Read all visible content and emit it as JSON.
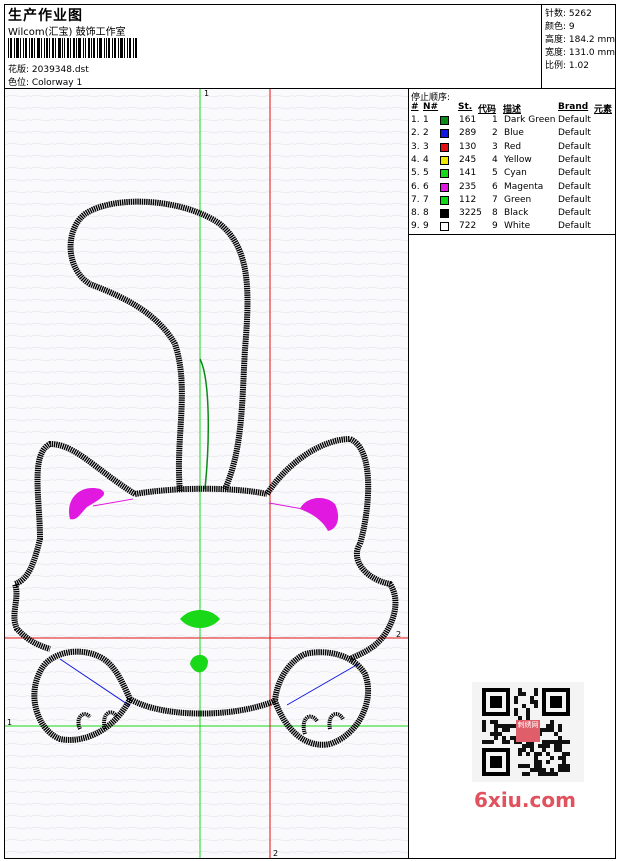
{
  "header": {
    "title": "生产作业图",
    "company": "Wilcom(汇宝) 鼓饰工作室",
    "design_label": "花版: 2039348.dst",
    "colorway_label": "色位: Colorway 1"
  },
  "stats": {
    "stitches": "针数: 5262",
    "colors": "颜色: 9",
    "height": "高度: 184.2 mm",
    "width": "宽度: 131.0 mm",
    "ratio": "比例: 1.02"
  },
  "stops": {
    "title": "停止顺序:",
    "columns": [
      "#",
      "N#",
      "St.",
      "代码",
      "描述",
      "Brand",
      "元素"
    ],
    "rows": [
      {
        "num": "1.",
        "n": "1",
        "color": "#0b8a18",
        "st": "161",
        "code": "1",
        "desc": "Dark Green",
        "brand": "Default"
      },
      {
        "num": "2.",
        "n": "2",
        "color": "#1018e0",
        "st": "289",
        "code": "2",
        "desc": "Blue",
        "brand": "Default"
      },
      {
        "num": "3.",
        "n": "3",
        "color": "#e01010",
        "st": "130",
        "code": "3",
        "desc": "Red",
        "brand": "Default"
      },
      {
        "num": "4.",
        "n": "4",
        "color": "#f0e800",
        "st": "245",
        "code": "4",
        "desc": "Yellow",
        "brand": "Default"
      },
      {
        "num": "5.",
        "n": "5",
        "color": "#18d818",
        "st": "141",
        "code": "5",
        "desc": "Cyan",
        "brand": "Default"
      },
      {
        "num": "6.",
        "n": "6",
        "color": "#e018e0",
        "st": "235",
        "code": "6",
        "desc": "Magenta",
        "brand": "Default"
      },
      {
        "num": "7.",
        "n": "7",
        "color": "#10d818",
        "st": "112",
        "code": "7",
        "desc": "Green",
        "brand": "Default"
      },
      {
        "num": "8.",
        "n": "8",
        "color": "#000000",
        "st": "3225",
        "code": "8",
        "desc": "Black",
        "brand": "Default"
      },
      {
        "num": "9.",
        "n": "9",
        "color": "#ffffff",
        "st": "722",
        "code": "9",
        "desc": "White",
        "brand": "Default"
      }
    ]
  },
  "guides": {
    "green_v_label": "1",
    "green_h_label": "1",
    "red_v_label": "2",
    "red_h_label": "2"
  },
  "watermark": {
    "qr_center_text": "刺绣网",
    "text": "6xiu.com"
  },
  "colors": {
    "guide_green": "#18d818",
    "guide_red": "#e01010",
    "stitch_black": "#000000",
    "jump_blue": "#1018e0",
    "jump_magenta": "#e018e0",
    "watermark_red": "#e0525e"
  }
}
